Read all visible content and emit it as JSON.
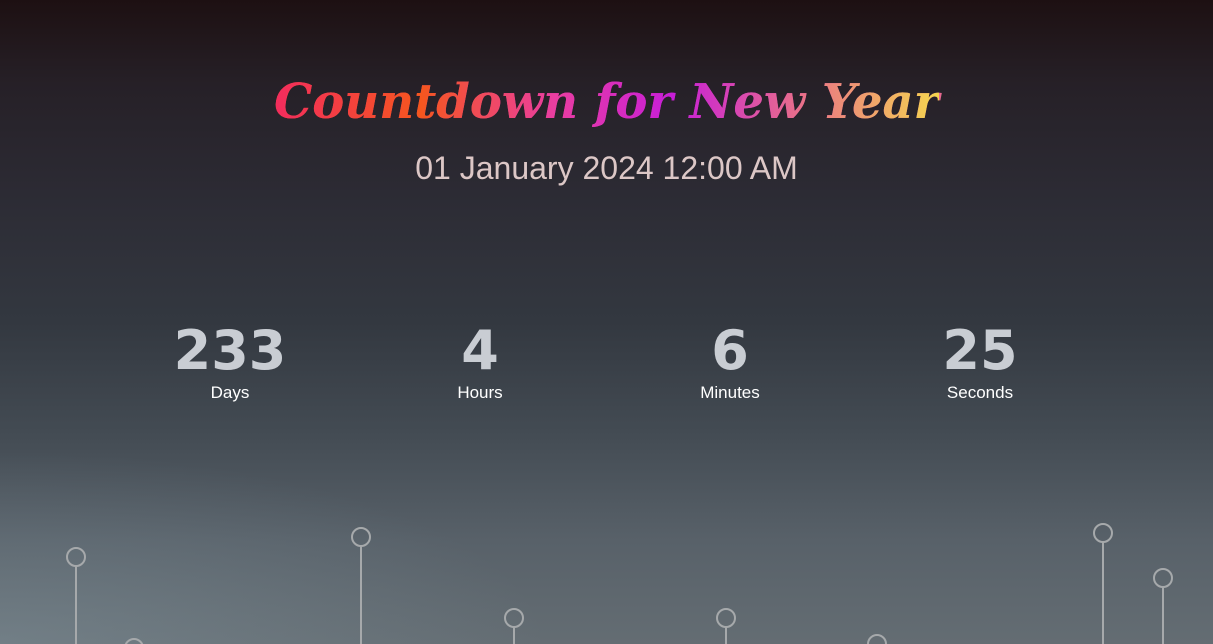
{
  "header": {
    "title": "Countdown for New Year",
    "target_date": "01 January 2024 12:00 AM"
  },
  "countdown": [
    {
      "value": "233",
      "label": "Days"
    },
    {
      "value": "4",
      "label": "Hours"
    },
    {
      "value": "6",
      "label": "Minutes"
    },
    {
      "value": "25",
      "label": "Seconds"
    }
  ],
  "colors": {
    "title_gradient": [
      "#f32c5e",
      "#f5561e",
      "#ea3ea0",
      "#c71ed8",
      "#ea7386",
      "#f5d64e"
    ],
    "subtitle": "#dcc7c6",
    "counter_value": "#c9cdd3",
    "counter_label": "#ffffff",
    "decoration": "#a6a9ab"
  }
}
